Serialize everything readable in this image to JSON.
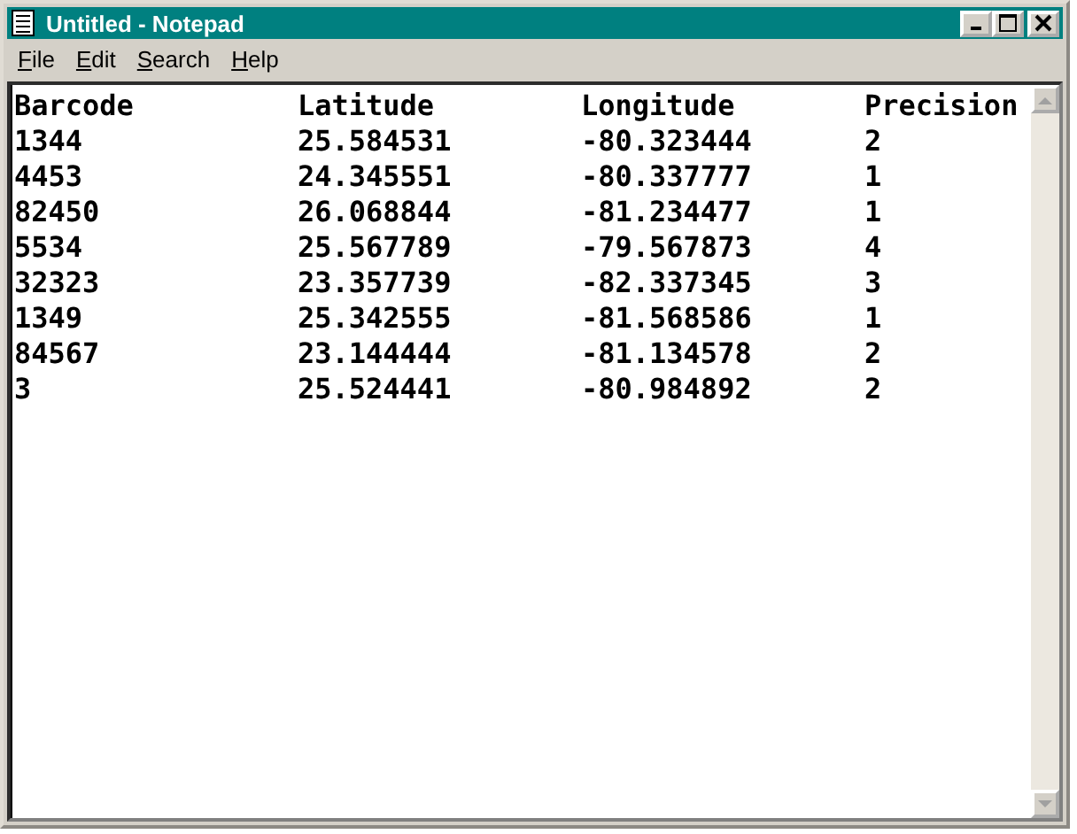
{
  "window": {
    "title": "Untitled - Notepad"
  },
  "menu": [
    "File",
    "Edit",
    "Search",
    "Help"
  ],
  "document": {
    "lines": [
      [
        "Barcode",
        "Latitude",
        "Longitude",
        "Precision"
      ],
      [
        "1344",
        "25.584531",
        "-80.323444",
        "2"
      ],
      [
        "4453",
        "24.345551",
        "-80.337777",
        "1"
      ],
      [
        "82450",
        "26.068844",
        "-81.234477",
        "1"
      ],
      [
        "5534",
        "25.567789",
        "-79.567873",
        "4"
      ],
      [
        "32323",
        "23.357739",
        "-82.337345",
        "3"
      ],
      [
        "1349",
        "25.342555",
        "-81.568586",
        "1"
      ],
      [
        "84567",
        "23.144444",
        "-81.134578",
        "2"
      ],
      [
        "3",
        "25.524441",
        "-80.984892",
        "2"
      ]
    ]
  }
}
